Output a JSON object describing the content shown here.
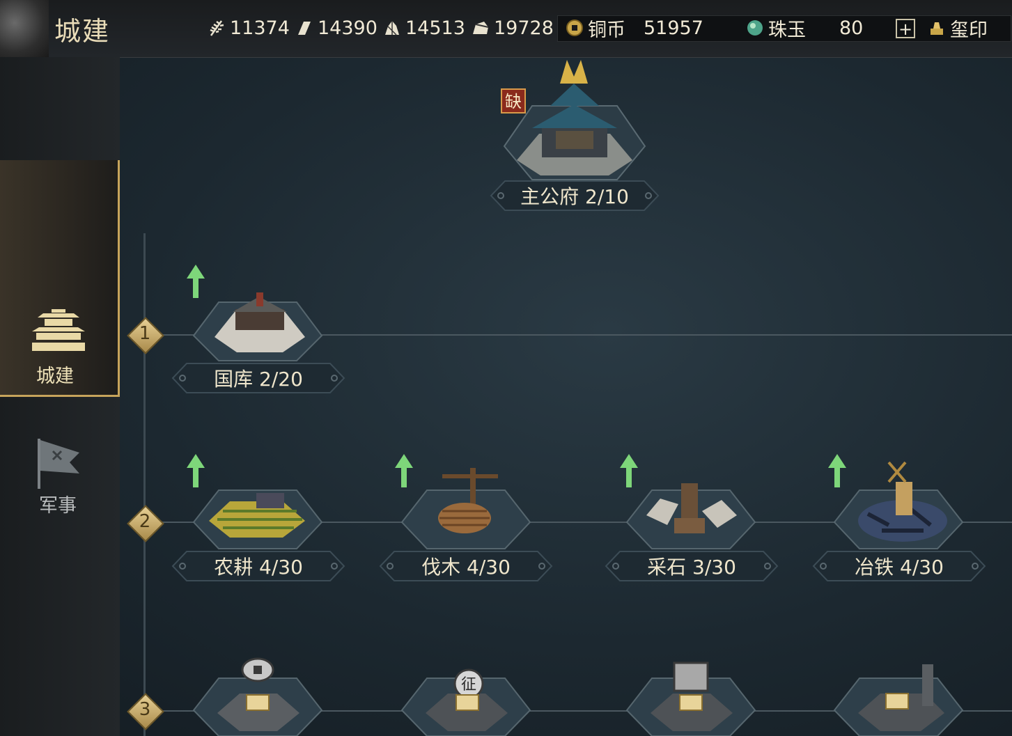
{
  "header": {
    "title": "城建",
    "resources": [
      {
        "icon": "grain-icon",
        "value": "11374"
      },
      {
        "icon": "wood-icon",
        "value": "14390"
      },
      {
        "icon": "stone-icon",
        "value": "14513"
      },
      {
        "icon": "iron-icon",
        "value": "19728"
      }
    ],
    "currency": {
      "copper_label": "铜币",
      "copper_value": "51957",
      "jade_label": "珠玉",
      "jade_value": "80",
      "add_label": "+",
      "seal_label": "玺印"
    }
  },
  "tabs": [
    {
      "label": "城建",
      "active": true
    },
    {
      "label": "军事",
      "active": false
    }
  ],
  "main_building": {
    "label": "主公府 2/10",
    "missing_tag": "缺"
  },
  "tiers": [
    {
      "number": "1",
      "buildings": [
        {
          "label": "国库 2/20",
          "upgradable": true
        }
      ]
    },
    {
      "number": "2",
      "buildings": [
        {
          "label": "农耕 4/30",
          "upgradable": true
        },
        {
          "label": "伐木 4/30",
          "upgradable": true
        },
        {
          "label": "采石 3/30",
          "upgradable": true
        },
        {
          "label": "冶铁 4/30",
          "upgradable": true
        }
      ]
    },
    {
      "number": "3",
      "buildings": [
        {
          "icon": "coin-building-icon",
          "locked": true
        },
        {
          "icon": "conscript-building-icon",
          "tag": "征",
          "locked": true
        },
        {
          "icon": "banner-building-icon",
          "locked": true
        },
        {
          "icon": "fortress-building-icon",
          "locked": true
        }
      ]
    }
  ],
  "colors": {
    "accent_gold": "#c7a45b",
    "upgrade_green": "#7ed67a",
    "missing_red": "#8a2a1c"
  }
}
